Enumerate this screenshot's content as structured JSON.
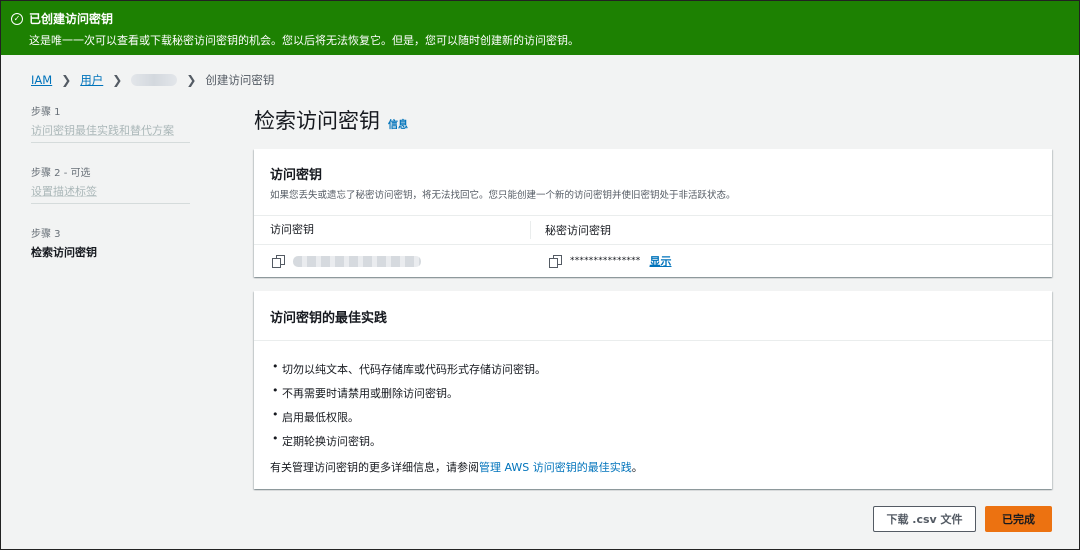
{
  "banner": {
    "title": "已创建访问密钥",
    "message": "这是唯一一次可以查看或下载秘密访问密钥的机会。您以后将无法恢复它。但是，您可以随时创建新的访问密钥。"
  },
  "breadcrumb": {
    "iam": "IAM",
    "users": "用户",
    "current": "创建访问密钥"
  },
  "steps": [
    {
      "num": "步骤 1",
      "label": "访问密钥最佳实践和替代方案"
    },
    {
      "num": "步骤 2 - 可选",
      "label": "设置描述标签"
    },
    {
      "num": "步骤 3",
      "label": "检索访问密钥"
    }
  ],
  "page": {
    "title": "检索访问密钥",
    "info": "信息"
  },
  "access_key_card": {
    "title": "访问密钥",
    "description": "如果您丢失或遗忘了秘密访问密钥，将无法找回它。您只能创建一个新的访问密钥并使旧密钥处于非活跃状态。",
    "col_access_key": "访问密钥",
    "col_secret_key": "秘密访问密钥",
    "secret_masked": "***************",
    "show_link": "显示"
  },
  "best_practices_card": {
    "title": "访问密钥的最佳实践",
    "items": [
      "切勿以纯文本、代码存储库或代码形式存储访问密钥。",
      "不再需要时请禁用或删除访问密钥。",
      "启用最低权限。",
      "定期轮换访问密钥。"
    ],
    "more_prefix": "有关管理访问密钥的更多详细信息，请参阅",
    "more_link": "管理 AWS 访问密钥的最佳实践",
    "more_suffix": "。"
  },
  "actions": {
    "download_csv": "下载 .csv 文件",
    "done": "已完成"
  },
  "colors": {
    "banner_bg": "#1d8102",
    "link": "#0073bb",
    "primary": "#ec7211"
  }
}
